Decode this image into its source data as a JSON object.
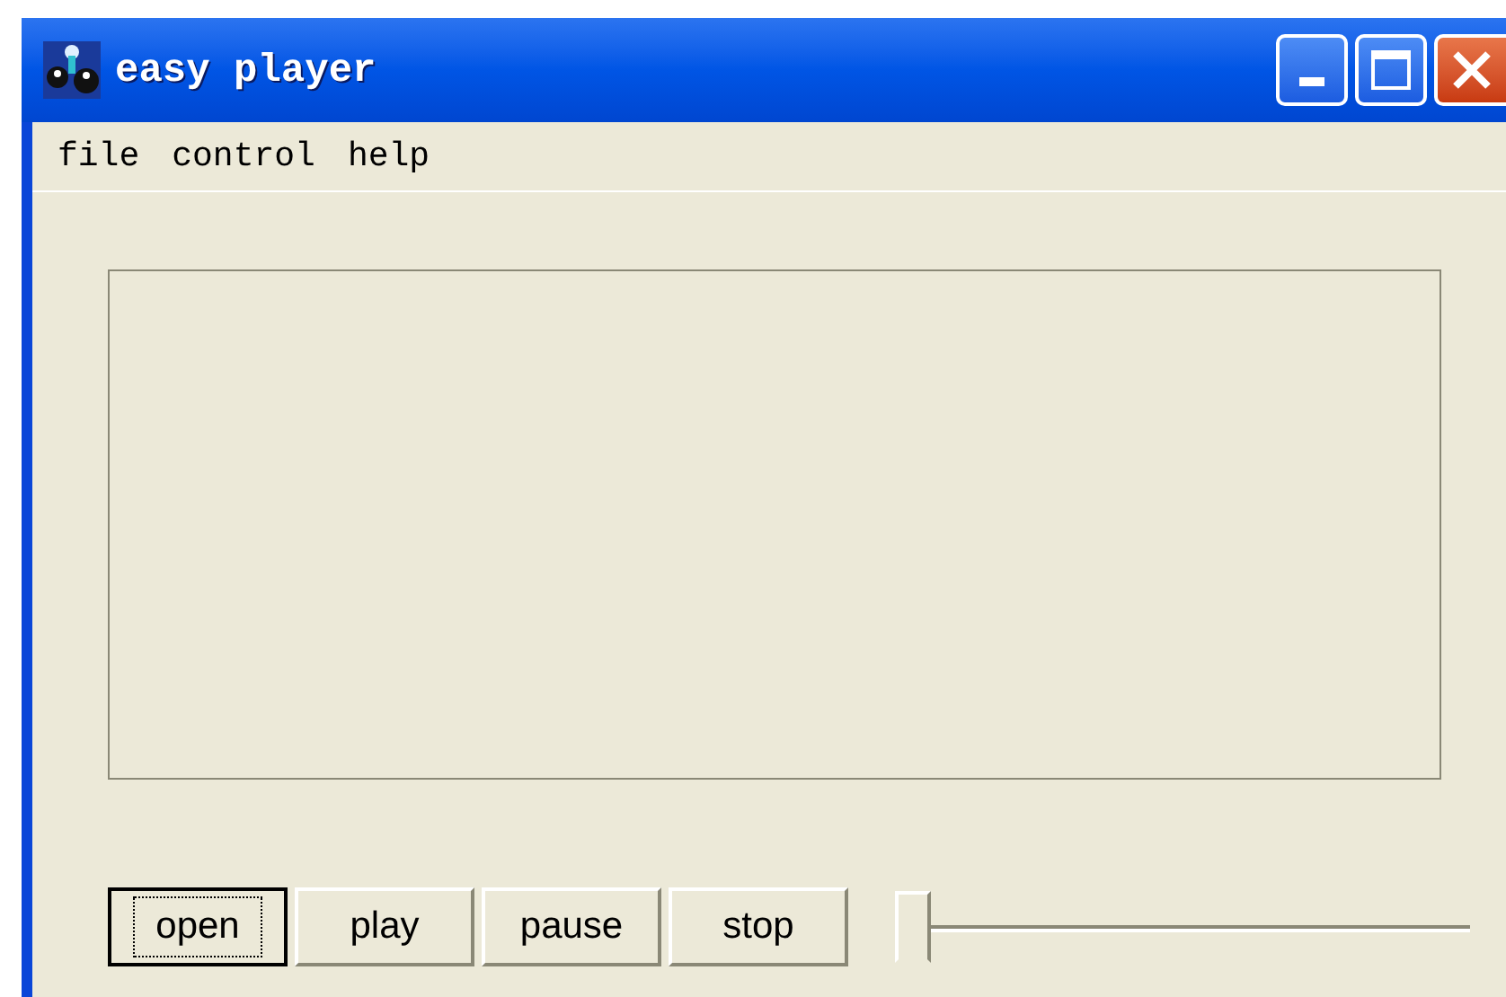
{
  "window": {
    "title": "easy player"
  },
  "menu": [
    "file",
    "control",
    "help"
  ],
  "buttons": [
    {
      "label": "open",
      "focused": true
    },
    {
      "label": "play",
      "focused": false
    },
    {
      "label": "pause",
      "focused": false
    },
    {
      "label": "stop",
      "focused": false
    }
  ],
  "slider": {
    "level": 0
  }
}
